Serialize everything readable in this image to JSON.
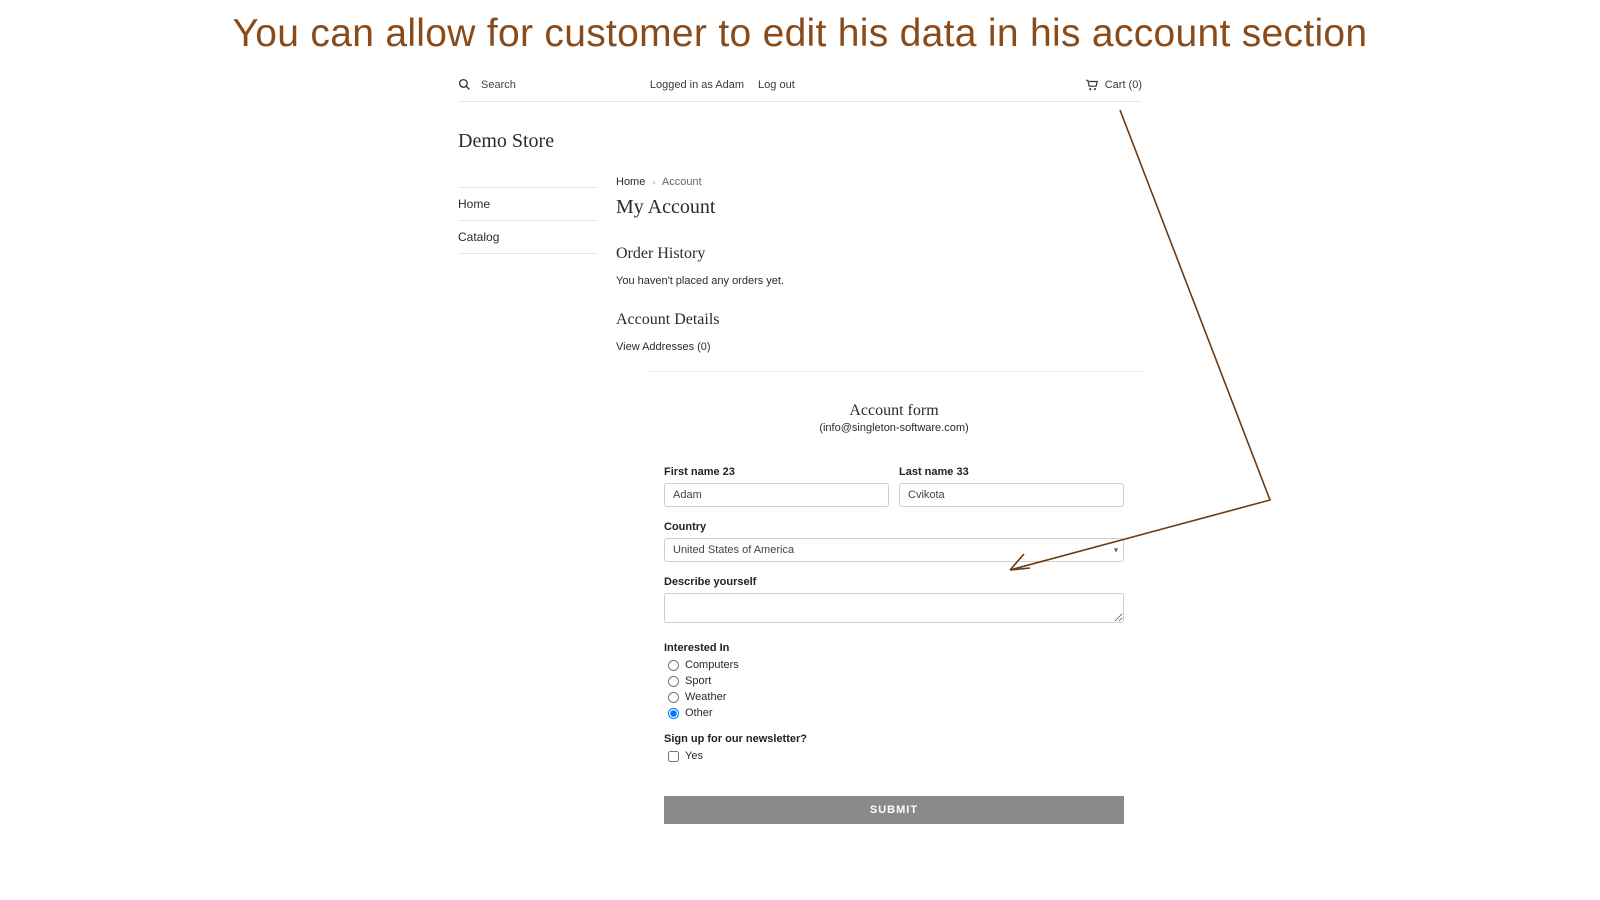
{
  "annotation": {
    "headline": "You can allow for customer to edit his data in his account section"
  },
  "header": {
    "search_label": "Search",
    "logged_in_as": "Logged in as Adam",
    "logout_label": "Log out",
    "cart_label": "Cart (0)"
  },
  "store": {
    "name": "Demo Store"
  },
  "sidebar": {
    "items": [
      {
        "label": "Home"
      },
      {
        "label": "Catalog"
      }
    ]
  },
  "breadcrumb": {
    "home": "Home",
    "current": "Account"
  },
  "account": {
    "page_title": "My Account",
    "order_history_title": "Order History",
    "order_history_empty": "You haven't placed any orders yet.",
    "details_title": "Account Details",
    "view_addresses": "View Addresses (0)"
  },
  "form": {
    "title": "Account form",
    "subtitle": "(info@singleton-software.com)",
    "first_name": {
      "label": "First name 23",
      "value": "Adam"
    },
    "last_name": {
      "label": "Last name 33",
      "value": "Cvikota"
    },
    "country": {
      "label": "Country",
      "value": "United States of America"
    },
    "describe": {
      "label": "Describe yourself",
      "value": ""
    },
    "interested": {
      "label": "Interested In",
      "options": [
        {
          "label": "Computers",
          "selected": false
        },
        {
          "label": "Sport",
          "selected": false
        },
        {
          "label": "Weather",
          "selected": false
        },
        {
          "label": "Other",
          "selected": true
        }
      ]
    },
    "newsletter": {
      "label": "Sign up for our newsletter?",
      "option": "Yes",
      "checked": false
    },
    "submit_label": "SUBMIT"
  }
}
